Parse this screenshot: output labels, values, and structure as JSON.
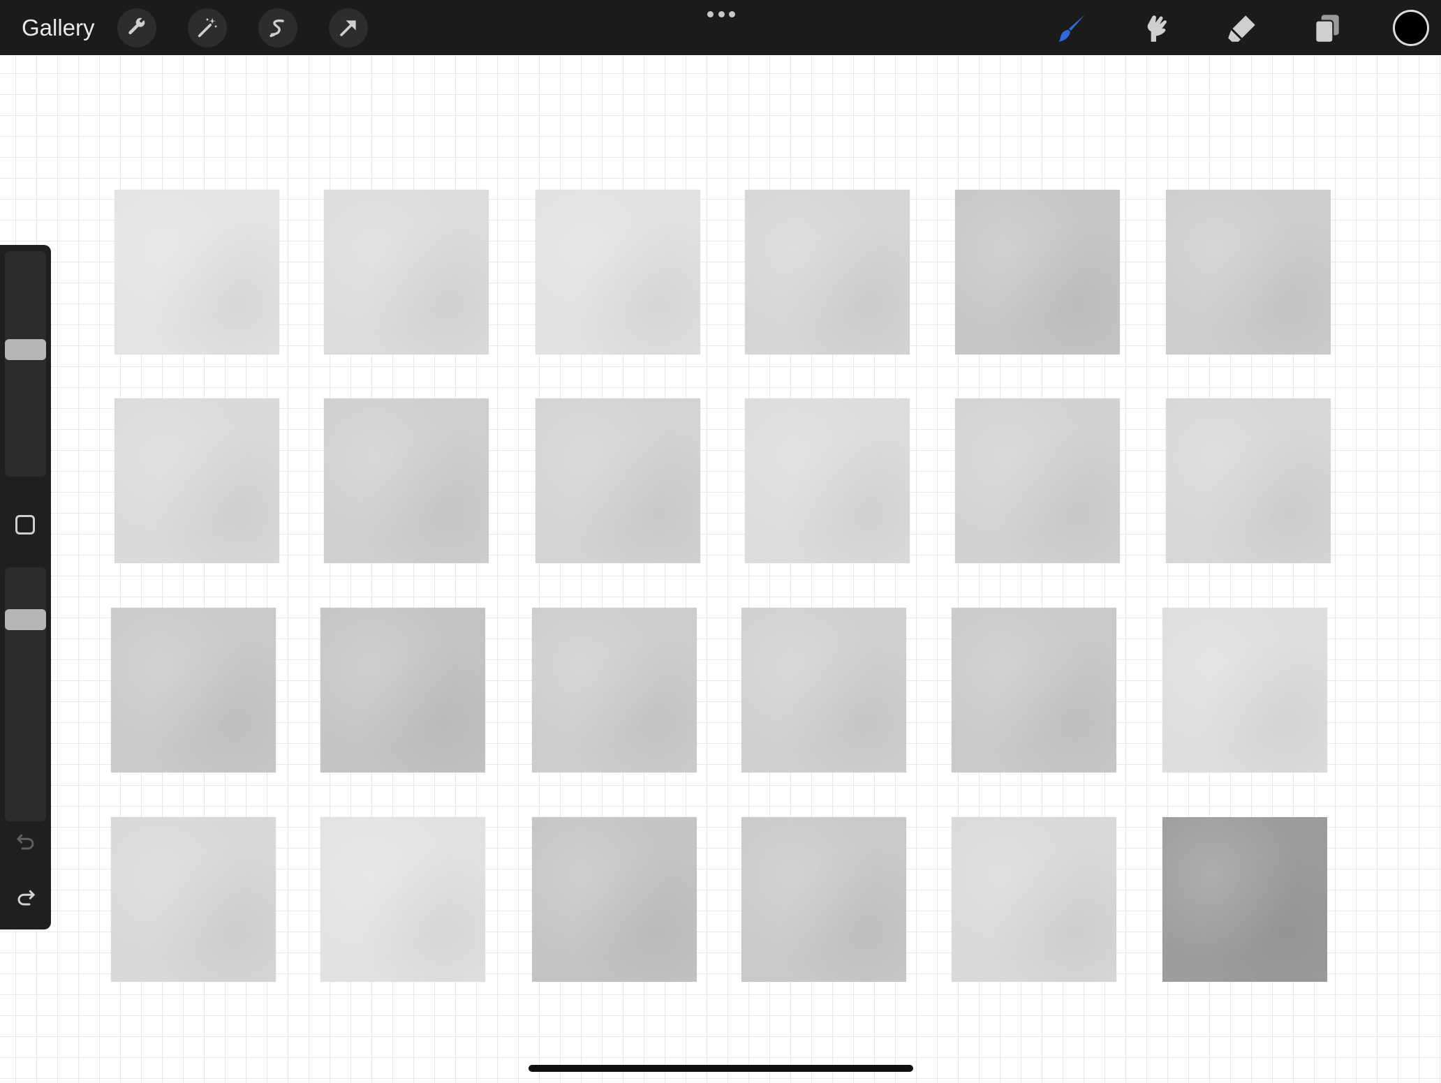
{
  "toolbar": {
    "gallery_label": "Gallery",
    "left_tools": [
      "wrench-icon",
      "magic-wand-icon",
      "selection-icon",
      "transform-arrow-icon"
    ],
    "right_tools": [
      "brush-icon",
      "smudge-icon",
      "eraser-icon",
      "layers-icon"
    ],
    "active_tool": "brush",
    "active_color": "#000000",
    "accent_color": "#2f6bd8"
  },
  "sidebar": {
    "brush_size_level": 0.57,
    "brush_opacity_level": 0.82,
    "icons": [
      "modify-square-icon",
      "undo-icon",
      "redo-icon"
    ]
  },
  "canvas": {
    "background": "#ffffff",
    "grid_color": "#e8e8e8",
    "texture_tiles": [
      [
        "#e3e3e3",
        "#dcdcdc",
        "#e1e1e1",
        "#d6d6d6",
        "#c6c6c6",
        "#cdcdcd"
      ],
      [
        "#dadada",
        "#cfcfcf",
        "#d3d3d3",
        "#dcdcdc",
        "#d2d2d2",
        "#d7d7d7"
      ],
      [
        "#c9c9c9",
        "#c4c4c4",
        "#cdcdcd",
        "#d0d0d0",
        "#c9c9c9",
        "#dedede"
      ],
      [
        "#d8d8d8",
        "#e2e2e2",
        "#c4c4c4",
        "#c9c9c9",
        "#d9d9d9",
        "#9c9c9c"
      ]
    ]
  }
}
